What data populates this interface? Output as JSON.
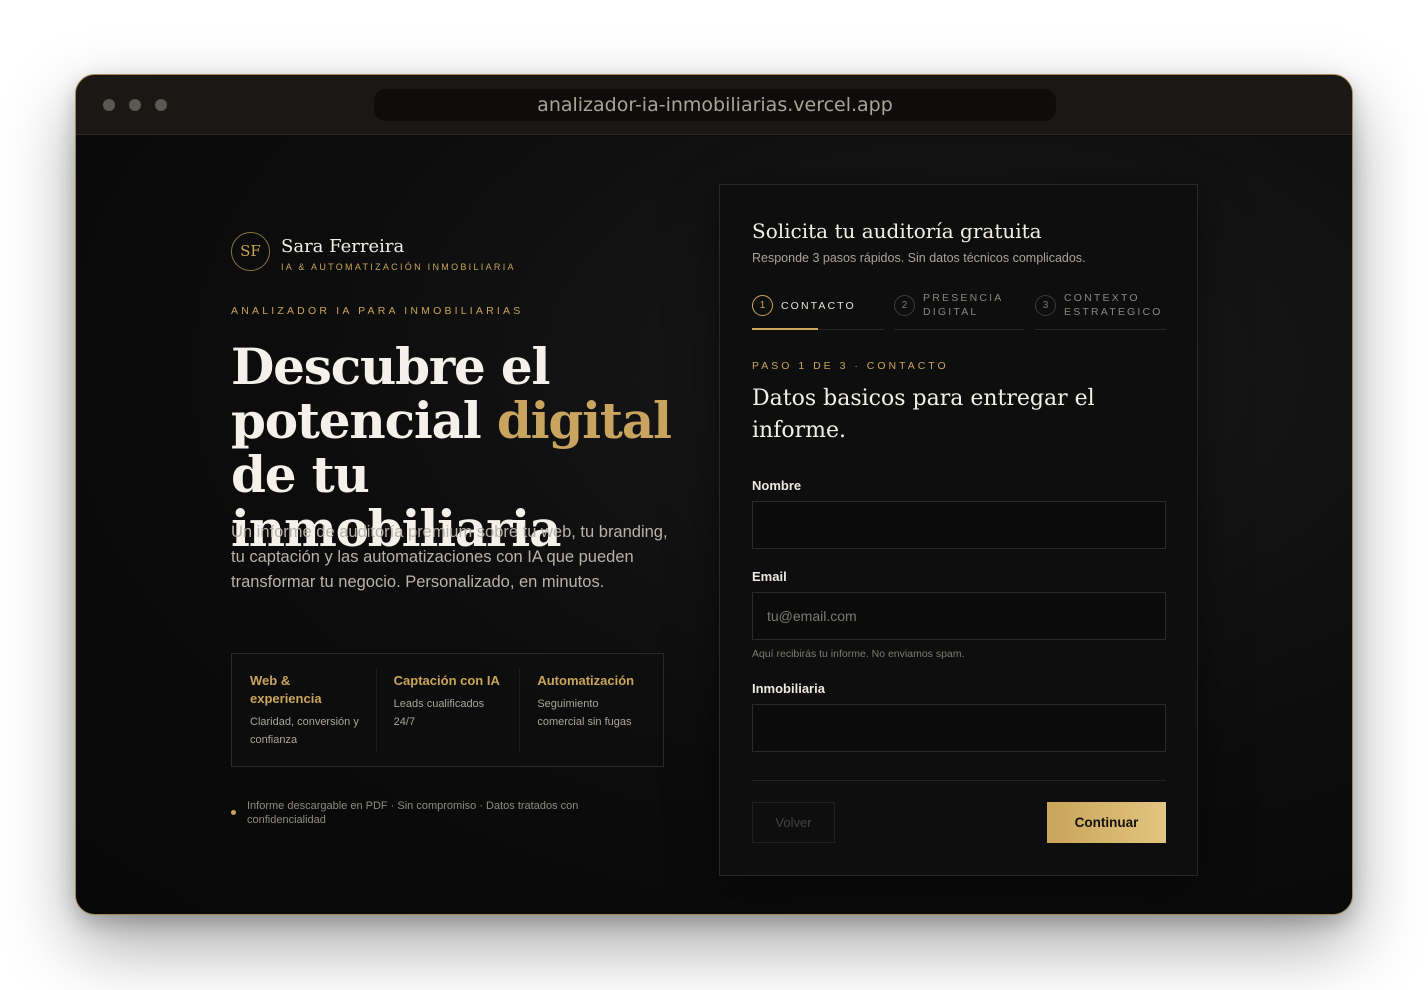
{
  "browser": {
    "url": "analizador-ia-inmobiliarias.vercel.app"
  },
  "brand": {
    "initials": "SF",
    "name": "Sara Ferreira",
    "tagline": "IA & AUTOMATIZACIÓN INMOBILIARIA"
  },
  "hero": {
    "eyebrow": "ANALIZADOR IA PARA INMOBILIARIAS",
    "title_part1": "Descubre el potencial ",
    "title_highlight": "digital",
    "title_part2": " de tu inmobiliaria",
    "lead": "Un informe de auditoría premium sobre tu web, tu branding, tu captación y las automatizaciones con IA que pueden transformar tu negocio. Personalizado, en minutos."
  },
  "features": [
    {
      "title": "Web & experiencia",
      "desc": "Claridad, conversión y confianza"
    },
    {
      "title": "Captación con IA",
      "desc": "Leads cualificados 24/7"
    },
    {
      "title": "Automatización",
      "desc": "Seguimiento comercial sin fugas"
    }
  ],
  "footnote": "Informe descargable en PDF · Sin compromiso · Datos tratados con confidencialidad",
  "form": {
    "title": "Solicita tu auditoría gratuita",
    "subtitle": "Responde 3 pasos rápidos. Sin datos técnicos complicados.",
    "steps": [
      {
        "num": "1",
        "label": "CONTACTO"
      },
      {
        "num": "2",
        "label": "PRESENCIA DIGITAL"
      },
      {
        "num": "3",
        "label": "CONTEXTO ESTRATEGICO"
      }
    ],
    "step_eyebrow": "PASO 1 DE 3 · CONTACTO",
    "step_heading": "Datos basicos para entregar el informe.",
    "fields": {
      "name": {
        "label": "Nombre",
        "value": "",
        "placeholder": ""
      },
      "email": {
        "label": "Email",
        "value": "",
        "placeholder": "tu@email.com",
        "help": "Aquí recibirás tu informe. No enviamos spam."
      },
      "company": {
        "label": "Inmobiliaria",
        "value": "",
        "placeholder": ""
      }
    },
    "back_label": "Volver",
    "next_label": "Continuar"
  }
}
